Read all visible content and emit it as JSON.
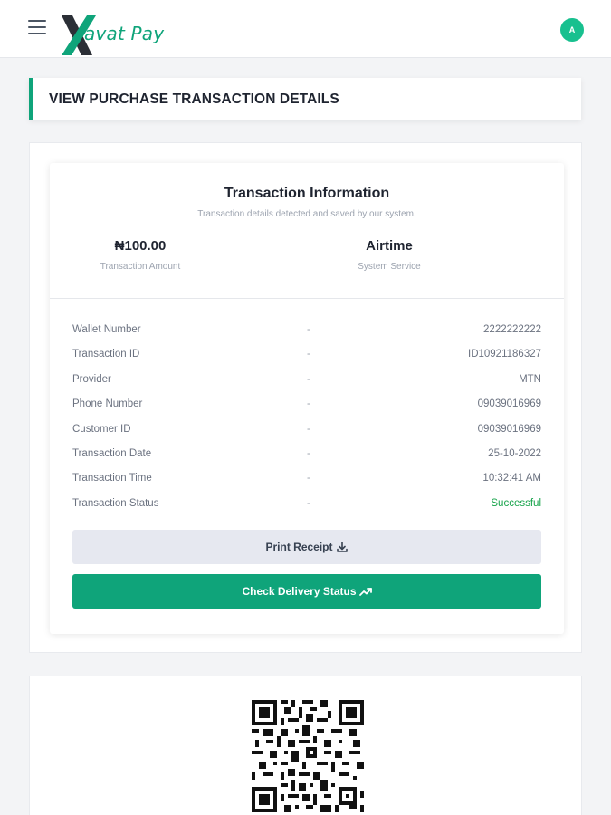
{
  "header": {
    "brand": "avat Pay",
    "brand_mark": "X",
    "avatar_initial": "A",
    "menu_icon": "hamburger-icon"
  },
  "page": {
    "title": "VIEW PURCHASE TRANSACTION DETAILS"
  },
  "transaction": {
    "heading": "Transaction Information",
    "subheading": "Transaction details detected and saved by our system.",
    "amount": "₦100.00",
    "amount_label": "Transaction Amount",
    "service": "Airtime",
    "service_label": "System Service",
    "separator": "-",
    "details": [
      {
        "label": "Wallet Number",
        "value": "2222222222"
      },
      {
        "label": "Transaction ID",
        "value": "ID10921186327"
      },
      {
        "label": "Provider",
        "value": "MTN"
      },
      {
        "label": "Phone Number",
        "value": "09039016969"
      },
      {
        "label": "Customer ID",
        "value": "09039016969"
      },
      {
        "label": "Transaction Date",
        "value": "25-10-2022"
      },
      {
        "label": "Transaction Time",
        "value": "10:32:41 AM"
      },
      {
        "label": "Transaction Status",
        "value": "Successful"
      }
    ]
  },
  "actions": {
    "print_label": "Print Receipt",
    "print_icon": "download-icon",
    "check_label": "Check Delivery Status",
    "check_icon": "trending-up-icon"
  },
  "colors": {
    "accent": "#0fa47a",
    "success": "#16a34a",
    "secondary_button": "#e6e8f0"
  }
}
